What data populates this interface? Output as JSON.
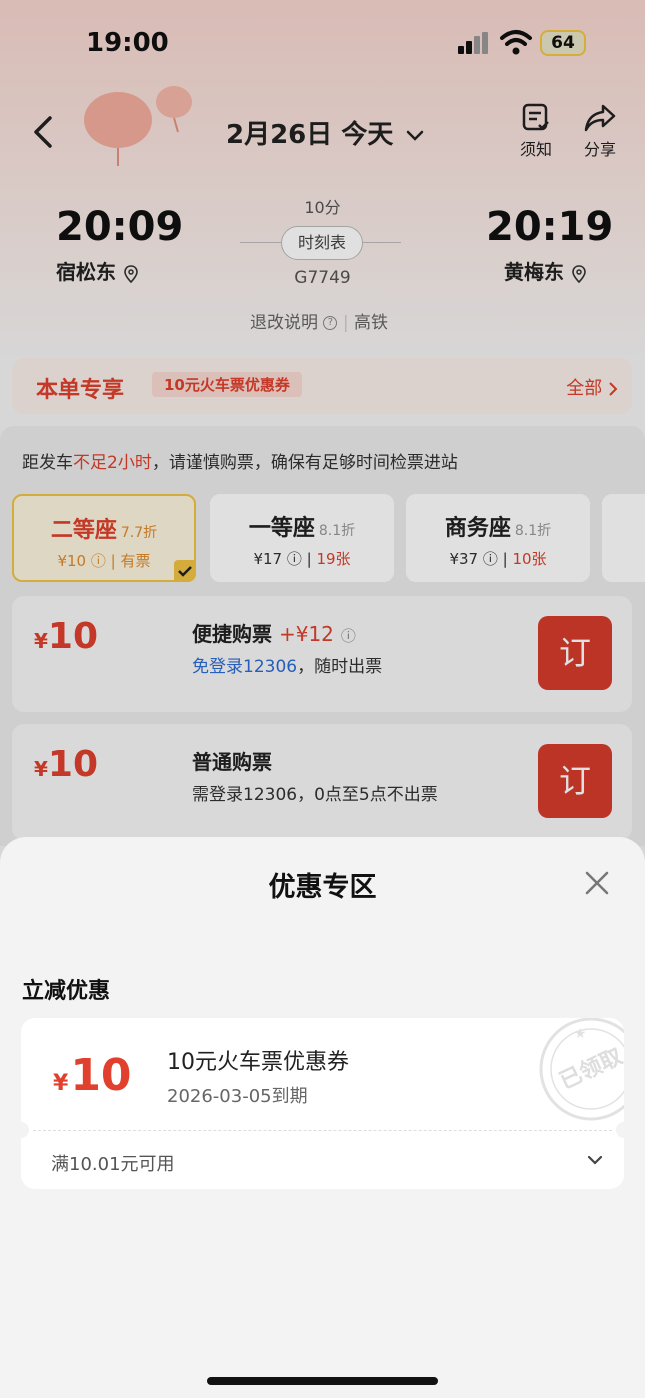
{
  "status_bar": {
    "time": "19:00",
    "battery": "64"
  },
  "nav": {
    "date": "2月26日 今天",
    "notice_label": "须知",
    "share_label": "分享"
  },
  "train": {
    "departure_time": "20:09",
    "departure_station": "宿松东",
    "arrival_time": "20:19",
    "arrival_station": "黄梅东",
    "duration": "10分",
    "timetable_label": "时刻表",
    "train_number": "G7749",
    "refund_label": "退改说明",
    "train_type": "高铁"
  },
  "promo": {
    "title": "本单专享",
    "tag": "10元火车票优惠券",
    "all_label": "全部"
  },
  "warning": {
    "prefix": "距发车",
    "highlight": "不足2小时",
    "suffix": "，请谨慎购票，确保有足够时间检票进站"
  },
  "seats": [
    {
      "name": "二等座",
      "discount": "7.7折",
      "price": "¥10",
      "availability": "有票",
      "selected": true
    },
    {
      "name": "一等座",
      "discount": "8.1折",
      "price": "¥17",
      "availability": "19张",
      "selected": false
    },
    {
      "name": "商务座",
      "discount": "8.1折",
      "price": "¥37",
      "availability": "10张",
      "selected": false
    }
  ],
  "tickets": [
    {
      "currency": "¥",
      "price": "10",
      "title": "便捷购票",
      "extra": "+¥12",
      "sub_link": "免登录12306",
      "sub_text": "，随时出票",
      "book_label": "订"
    },
    {
      "currency": "¥",
      "price": "10",
      "title": "普通购票",
      "sub_text": "需登录12306，0点至5点不出票",
      "book_label": "订"
    }
  ],
  "sheet": {
    "title": "优惠专区",
    "section_title": "立减优惠",
    "coupon": {
      "currency": "¥",
      "amount": "10",
      "name": "10元火车票优惠券",
      "expiry": "2026-03-05到期",
      "condition": "满10.01元可用",
      "stamp_text": "已领取"
    }
  }
}
